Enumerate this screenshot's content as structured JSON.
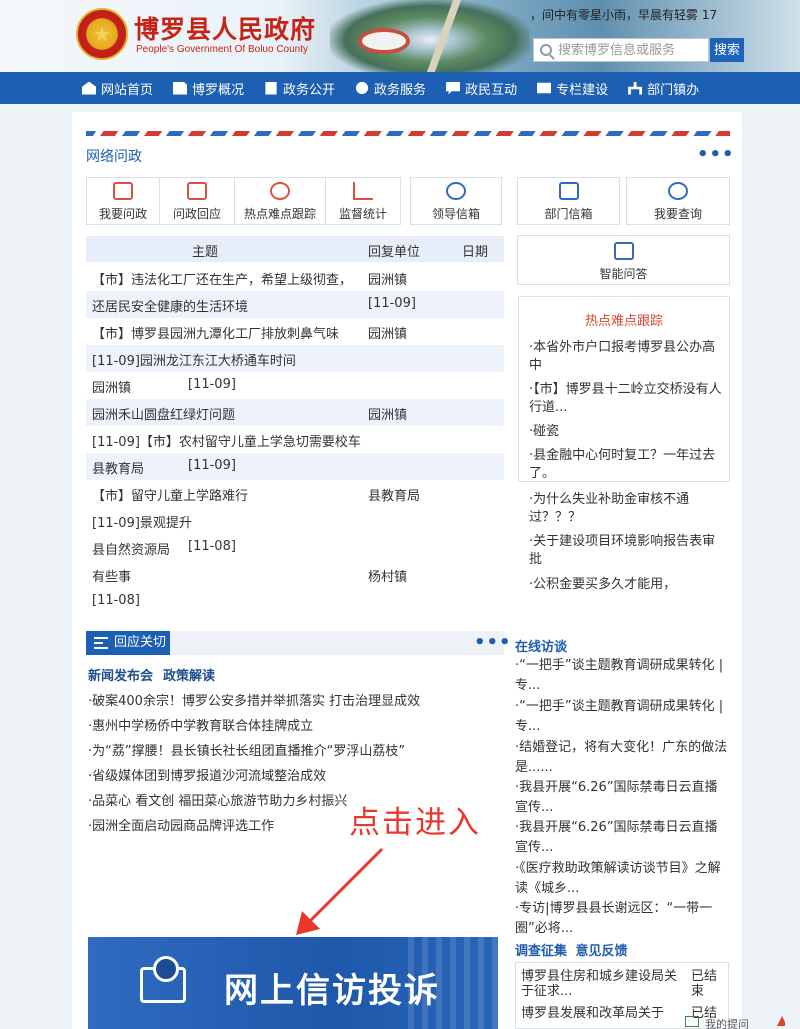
{
  "header": {
    "title": "博罗县人民政府",
    "subtitle": "People's Government Of Boluo County",
    "weather": "，间中有零星小雨，早晨有轻雾 17",
    "search_placeholder": "搜索博罗信息或服务",
    "search_button": "搜索"
  },
  "nav": [
    {
      "label": "网站首页",
      "icon": "home-icon"
    },
    {
      "label": "博罗概况",
      "icon": "building-icon"
    },
    {
      "label": "政务公开",
      "icon": "document-icon"
    },
    {
      "label": "政务服务",
      "icon": "users-icon"
    },
    {
      "label": "政民互动",
      "icon": "chat-icon"
    },
    {
      "label": "专栏建设",
      "icon": "book-icon"
    },
    {
      "label": "部门镇办",
      "icon": "org-tree-icon"
    }
  ],
  "wenzheng": {
    "title": "网络问政",
    "tools": [
      {
        "label": "我要问政"
      },
      {
        "label": "问政回应"
      },
      {
        "label": "热点难点跟踪"
      },
      {
        "label": "监督统计"
      },
      {
        "label": "领导信箱"
      },
      {
        "label": "部门信箱"
      },
      {
        "label": "我要查询"
      },
      {
        "label": "智能问答"
      }
    ],
    "table_headers": {
      "subject": "主题",
      "unit": "回复单位",
      "date": "日期"
    },
    "rows": [
      {
        "a": "【市】违法化工厂还在生产，希望上级彻查，",
        "b": "园洲镇"
      },
      {
        "a": "还居民安全健康的生活环境",
        "b": "[11-09]"
      },
      {
        "a": "【市】博罗县园洲九潭化工厂排放刺鼻气味",
        "b": "园洲镇"
      },
      {
        "a": "[11-09]园洲龙江东江大桥通车时间",
        "b": ""
      },
      {
        "a": "园洲镇",
        "a2": "[11-09]",
        "b": ""
      },
      {
        "a": "园洲禾山圆盘红绿灯问题",
        "b": "园洲镇"
      },
      {
        "a": "[11-09]【市】农村留守儿童上学急切需要校车",
        "b": ""
      },
      {
        "a": "县教育局",
        "a2": "[11-09]",
        "b": ""
      },
      {
        "a": "【市】留守儿童上学路难行",
        "b": "县教育局"
      },
      {
        "a": "[11-09]景观提升",
        "b": ""
      },
      {
        "a": "县自然资源局",
        "a2": "[11-08]",
        "b": ""
      },
      {
        "a": "有些事",
        "b": "杨村镇"
      },
      {
        "a": "[11-08]",
        "b": ""
      }
    ],
    "hot_title": "热点难点跟踪",
    "hot_items": [
      "·本省外市户口报考博罗县公办高中",
      "·【市】博罗县十二岭立交桥没有人行道...",
      "·碰瓷",
      "·县金融中心何时复工？一年过去了。",
      "·为什么失业补助金审核不通过？？？",
      "·关于建设项目环境影响报告表审批",
      "·公积金要买多久才能用，"
    ]
  },
  "response": {
    "tab": "回应关切",
    "sub_tabs": [
      "新闻发布会",
      "政策解读"
    ],
    "news": [
      "·破案400余宗！博罗公安多措并举抓落实 打击治理显成效",
      "·惠州中学杨侨中学教育联合体挂牌成立",
      "·为“荔”撑腰！县长镇长社长组团直播推介“罗浮山荔枝”",
      "·省级媒体团到博罗报道沙河流域整治成效",
      "·品菜心 看文创 福田菜心旅游节助力乡村振兴",
      "·园洲全面启动园商品牌评选工作"
    ]
  },
  "annotation": "点击进入",
  "banner_text": "网上信访投诉",
  "online_talk": {
    "title": "在线访谈",
    "items": [
      "·“一把手”谈主题教育调研成果转化 | 专...",
      "·“一把手”谈主题教育调研成果转化 | 专...",
      "·结婚登记，将有大变化！广东的做法是......",
      "·我县开展“6.26”国际禁毒日云直播宣传...",
      "·我县开展“6.26”国际禁毒日云直播宣传...",
      "·《医疗救助政策解读访谈节目》之解读《城乡...",
      "·专访|博罗县县长谢远区：“一带一圈”必将..."
    ]
  },
  "survey": {
    "tabs": [
      "调查征集",
      "意见反馈"
    ],
    "items": [
      {
        "text": "博罗县住房和城乡建设局关于征求...",
        "status": "已结束"
      },
      {
        "text": "博罗县发展和改革局关于",
        "status": "已结"
      }
    ]
  },
  "corner_text": "我的提问"
}
